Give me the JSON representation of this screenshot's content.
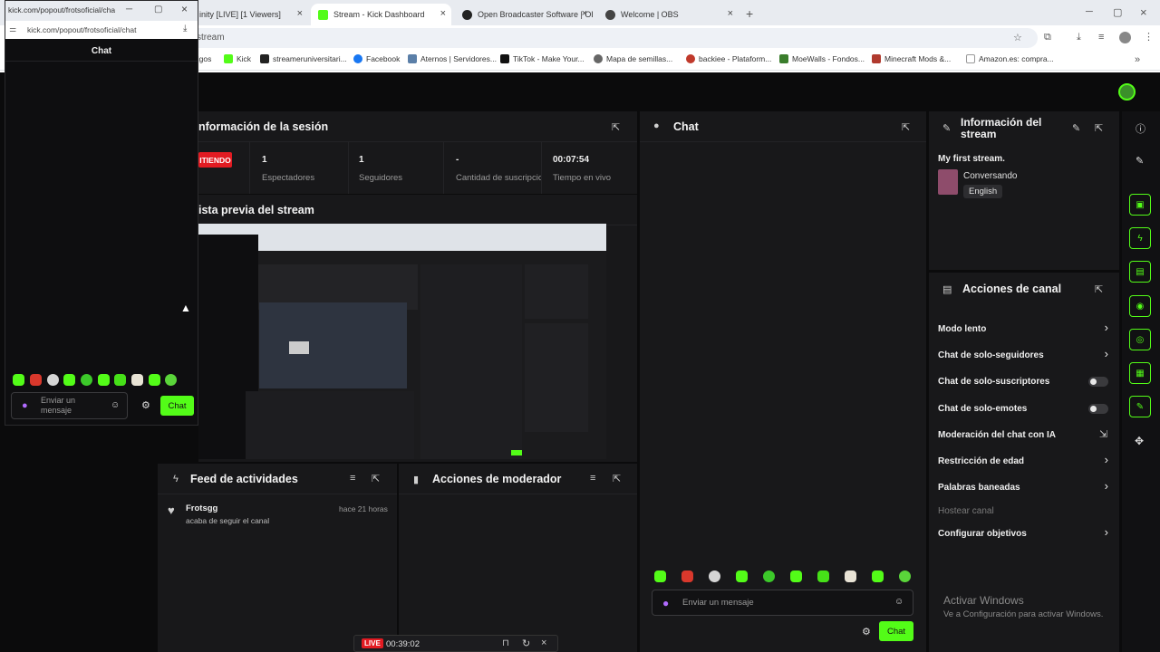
{
  "tabs": [
    {
      "label": "inity [LIVE] [1 Viewers]"
    },
    {
      "label": "Stream - Kick Dashboard"
    },
    {
      "label": "Open Broadcaster Software | OB"
    },
    {
      "label": "Welcome | OBS"
    }
  ],
  "address": {
    "url": "stream"
  },
  "bookmarks": [
    {
      "label": "nigos"
    },
    {
      "label": "Kick"
    },
    {
      "label": "streameruniversitari..."
    },
    {
      "label": "Facebook"
    },
    {
      "label": "Aternos | Servidores..."
    },
    {
      "label": "TikTok - Make Your..."
    },
    {
      "label": "Mapa de semillas..."
    },
    {
      "label": "backiee - Plataform..."
    },
    {
      "label": "MoeWalls - Fondos..."
    },
    {
      "label": "Minecraft Mods &..."
    },
    {
      "label": "Amazon.es: compra..."
    }
  ],
  "session": {
    "title": "nformación de la sesión",
    "badge": "ITIENDO",
    "stats": [
      {
        "value": "1",
        "label": "Espectadores"
      },
      {
        "value": "1",
        "label": "Seguidores"
      },
      {
        "value": "-",
        "label": "Cantidad de suscripciones"
      },
      {
        "value": "00:07:54",
        "label": "Tiempo en vivo"
      }
    ]
  },
  "preview": {
    "title": "ista previa del stream"
  },
  "chat": {
    "title": "Chat",
    "placeholder": "Enviar un mensaje",
    "send_label": "Chat"
  },
  "stream_info": {
    "title": "Información del stream",
    "stream_title": "My first stream.",
    "category": "Conversando",
    "language": "English"
  },
  "channel_actions": {
    "title": "Acciones de canal",
    "items": [
      {
        "label": "Modo lento",
        "control": "chevron"
      },
      {
        "label": "Chat de solo-seguidores",
        "control": "chevron"
      },
      {
        "label": "Chat de solo-suscriptores",
        "control": "toggle"
      },
      {
        "label": "Chat de solo-emotes",
        "control": "toggle"
      },
      {
        "label": "Moderación del chat con IA",
        "control": "external"
      },
      {
        "label": "Restricción de edad",
        "control": "chevron"
      },
      {
        "label": "Palabras baneadas",
        "control": "chevron"
      },
      {
        "label": "Hostear canal",
        "control": "none"
      },
      {
        "label": "Configurar objetivos",
        "control": "chevron"
      }
    ]
  },
  "activity": {
    "title": "Feed de actividades",
    "item_user": "Frotsgg",
    "item_time": "hace 21 horas",
    "item_text": "acaba de seguir el canal"
  },
  "moderator": {
    "title": "Acciones de moderador"
  },
  "popout": {
    "url": "kick.com/popout/frotsoficial/chat",
    "title_bar": "kick.com/popout/frotsoficial/chat",
    "chat_title": "Chat",
    "placeholder": "Enviar un mensaje",
    "send_label": "Chat"
  },
  "live_bar": {
    "badge": "LIVE",
    "time": "00:39:02"
  },
  "watermark": {
    "line1": "Activar Windows",
    "line2": "Ve a Configuración para activar Windows."
  },
  "colors": {
    "accent": "#53fc18",
    "live_red": "#e21b22",
    "panel": "#18181a"
  }
}
